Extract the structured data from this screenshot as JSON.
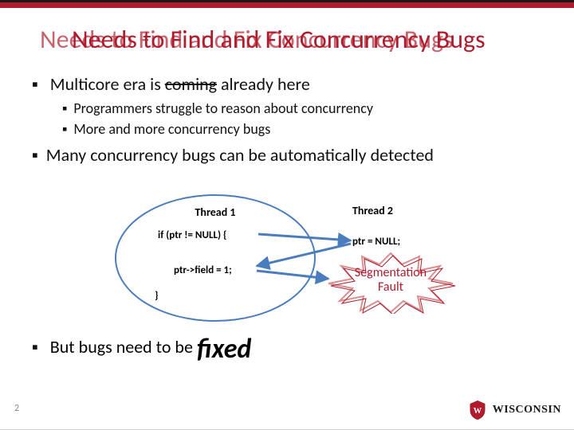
{
  "title": {
    "layer_a": "Needs to Find and Fix Concurrency Bugs",
    "layer_b": "Needs to Find and Fix Concurrency Bugs"
  },
  "bullets": {
    "b1_pre": "Multicore era is ",
    "b1_strike": "coming",
    "b1_post": " already here",
    "b1_sub1": "Programmers struggle to reason about concurrency",
    "b1_sub2": "More and more concurrency bugs",
    "b2": "Many concurrency bugs can be automatically detected",
    "b3_pre": "But bugs need to be ",
    "b3_fixed": "fixed"
  },
  "diagram": {
    "thread1": "Thread 1",
    "thread2": "Thread 2",
    "code1": "if (ptr != NULL) {",
    "code2": "ptr->field = 1;",
    "code3": "}",
    "ptrnull": "ptr = NULL;",
    "fault_l1": "Segmentation",
    "fault_l2": "Fault"
  },
  "footer": {
    "page": "2",
    "univ": "WISCONSIN"
  }
}
